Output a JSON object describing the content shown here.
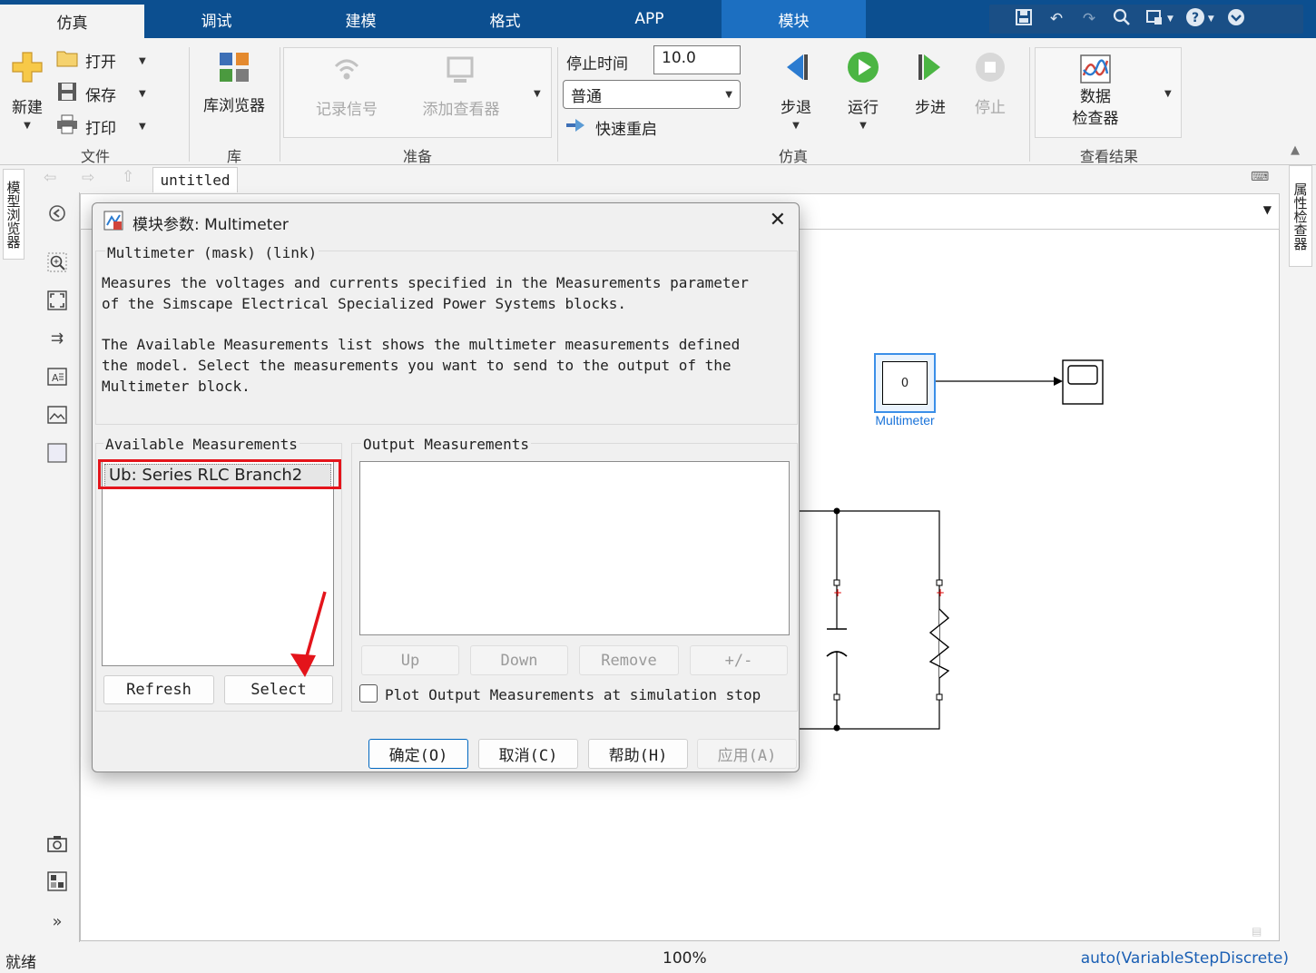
{
  "tabs": [
    {
      "label": "仿真",
      "active": true
    },
    {
      "label": "调试"
    },
    {
      "label": "建模"
    },
    {
      "label": "格式"
    },
    {
      "label": "APP"
    },
    {
      "label": "模块",
      "highlight": true
    }
  ],
  "ribbon": {
    "file": {
      "new_label": "新建",
      "open_label": "打开",
      "save_label": "保存",
      "print_label": "打印",
      "group_label": "文件"
    },
    "library": {
      "browser_label": "库浏览器",
      "group_label": "库"
    },
    "prepare": {
      "log_signals_label": "记录信号",
      "add_viewer_label": "添加查看器",
      "group_label": "准备"
    },
    "simulation": {
      "stop_time_label": "停止时间",
      "stop_time_value": "10.0",
      "mode_value": "普通",
      "fast_restart_label": "快速重启",
      "step_back_label": "步退",
      "run_label": "运行",
      "step_forward_label": "步进",
      "stop_label": "停止",
      "group_label": "仿真"
    },
    "review": {
      "inspector_label_line1": "数据",
      "inspector_label_line2": "检查器",
      "group_label": "查看结果"
    }
  },
  "side": {
    "model_browser_label": "模型浏览器",
    "property_inspector_label": "属性检查器"
  },
  "breadcrumb": {
    "model_tab": "untitled"
  },
  "canvas": {
    "multimeter_value": "0",
    "multimeter_label": "Multimeter"
  },
  "statusbar": {
    "status": "就绪",
    "zoom": "100%",
    "solver": "auto(VariableStepDiscrete)"
  },
  "dialog": {
    "title": "模块参数: Multimeter",
    "mask_heading": "Multimeter (mask) (link)",
    "description_p1_line1": "Measures the voltages and currents specified in the Measurements parameter",
    "description_p1_line2": "of the Simscape Electrical Specialized Power Systems blocks.",
    "description_p2_line1": "The Available Measurements list shows the multimeter measurements defined",
    "description_p2_line2": "the model. Select the measurements you want to send to the output of the",
    "description_p2_line3": "Multimeter block.",
    "available": {
      "legend": "Available Measurements",
      "items": [
        "Ub: Series RLC Branch2"
      ],
      "refresh_label": "Refresh",
      "select_label": "Select"
    },
    "output": {
      "legend": "Output Measurements",
      "up_label": "Up",
      "down_label": "Down",
      "remove_label": "Remove",
      "sign_label": "+/-",
      "plot_checkbox_label": "Plot Output Measurements at simulation stop",
      "plot_checked": false
    },
    "buttons": {
      "ok": "确定(O)",
      "cancel": "取消(C)",
      "help": "帮助(H)",
      "apply": "应用(A)"
    }
  },
  "colors": {
    "tab_bar": "#0c4f90",
    "tab_highlight": "#1c6fc1",
    "accent": "#0067c0",
    "annotation_red": "#e4141b",
    "selection_blue": "#1a73d9"
  }
}
